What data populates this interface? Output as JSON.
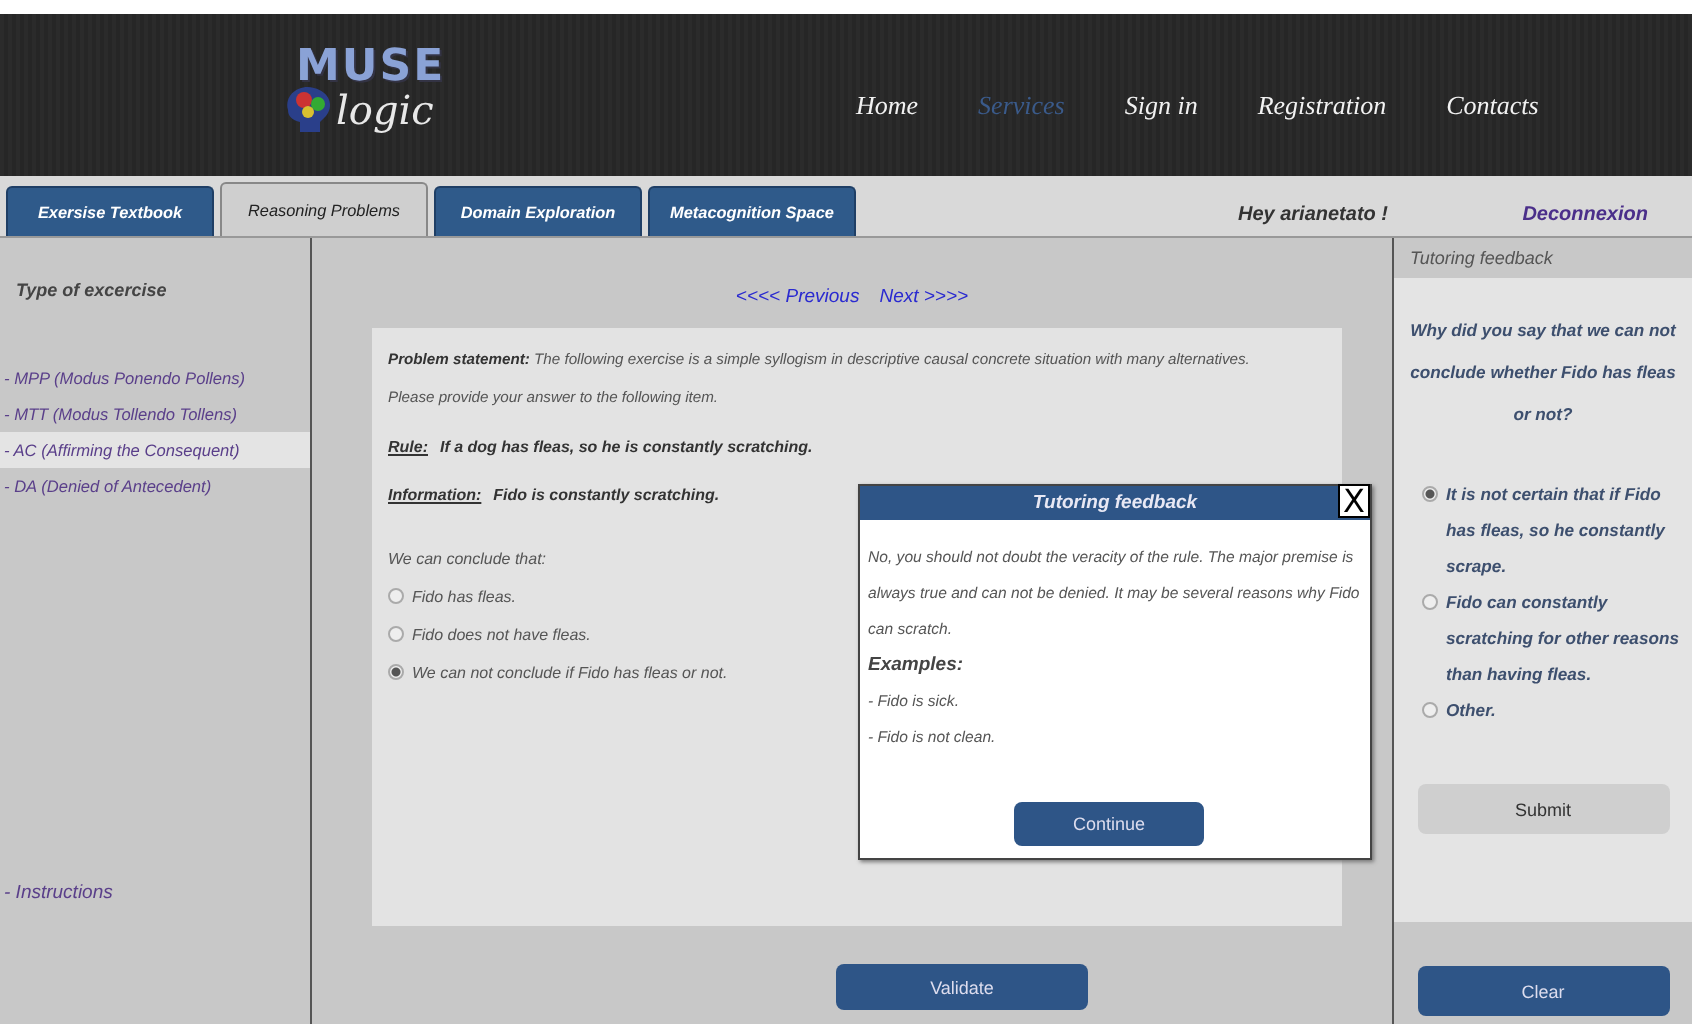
{
  "logo": {
    "top": "MUSE",
    "bottom": "logic"
  },
  "nav": [
    {
      "label": "Home",
      "selected": false
    },
    {
      "label": "Services",
      "selected": true
    },
    {
      "label": "Sign in",
      "selected": false
    },
    {
      "label": "Registration",
      "selected": false
    },
    {
      "label": "Contacts",
      "selected": false
    }
  ],
  "user": {
    "greeting": "Hey arianetato !",
    "logout": "Deconnexion"
  },
  "tabs": [
    {
      "label": "Exersise Textbook",
      "selected": false
    },
    {
      "label": "Reasoning Problems",
      "selected": true
    },
    {
      "label": "Domain Exploration",
      "selected": false
    },
    {
      "label": "Metacognition Space",
      "selected": false
    }
  ],
  "sidebar": {
    "title": "Type of excercise",
    "items": [
      {
        "label": "- MPP (Modus Ponendo Pollens)",
        "selected": false
      },
      {
        "label": "- MTT (Modus Tollendo Tollens)",
        "selected": false
      },
      {
        "label": "- AC (Affirming the Consequent)",
        "selected": true
      },
      {
        "label": "- DA (Denied of Antecedent)",
        "selected": false
      }
    ],
    "footer_link": "- Instructions"
  },
  "pagination": {
    "previous": "<<<< Previous",
    "next": "Next >>>>"
  },
  "problem": {
    "statement": "**Problem statement:** The following exercise is a simple syllogism in descriptive causal concrete situation with many alternatives.",
    "instruction": "Please provide your answer to the following item.",
    "rule_label": "Rule:",
    "rule": "If a dog has fleas, so he is constantly scratching.",
    "information_label": "Information:",
    "information": "Fido is constantly scratching.",
    "prompt": "We can conclude that:",
    "options": [
      {
        "label": "Fido has fleas.",
        "selected": false
      },
      {
        "label": "Fido does not have fleas.",
        "selected": false
      },
      {
        "label": "We can not conclude if Fido has fleas or not.",
        "selected": true
      }
    ]
  },
  "validate_button": "Validate",
  "modal": {
    "title": "Tutoring feedback",
    "close": "X",
    "message": "No, you should not doubt the veracity of the rule. The major premise is always true and can not be denied. It may be several reasons why Fido can scratch.",
    "examples_label": "Examples:",
    "examples": [
      "- Fido is sick.",
      "- Fido is not clean."
    ],
    "button": "Continue"
  },
  "feedback_panel": {
    "title": "Tutoring feedback",
    "question": "Why did you say that we can not conclude whether Fido has fleas or not?",
    "options": [
      {
        "label": "It is not certain that if Fido has fleas, so he constantly scrape.",
        "selected": true
      },
      {
        "label": "Fido can constantly scratching for other reasons than having fleas.",
        "selected": false
      },
      {
        "label": "Other.",
        "selected": false
      }
    ],
    "submit": "Submit",
    "clear": "Clear"
  }
}
